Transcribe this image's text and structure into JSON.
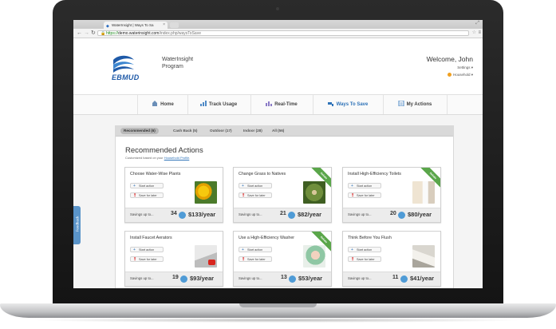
{
  "browser": {
    "tab_title": "WaterInsight | Ways To Sa",
    "url_prefix": "https://",
    "url_host": "demo.waterinsight.com",
    "url_path": "/index.php/waysToSave",
    "back_icon": "back-arrow-icon",
    "forward_icon": "forward-arrow-icon",
    "reload_icon": "reload-icon"
  },
  "header": {
    "logo_text": "EBMUD",
    "program_line1": "WaterInsight",
    "program_line2": "Program",
    "welcome": "Welcome, John",
    "settings": "Settings ▾",
    "household": "Household ▾"
  },
  "nav": {
    "items": [
      {
        "label": "Home",
        "icon": "home-icon"
      },
      {
        "label": "Track Usage",
        "icon": "chart-icon"
      },
      {
        "label": "Real-Time",
        "icon": "realtime-chart-icon"
      },
      {
        "label": "Ways To Save",
        "icon": "faucet-icon"
      },
      {
        "label": "My Actions",
        "icon": "clipboard-icon"
      }
    ]
  },
  "filters": {
    "items": [
      "Recommended (6)",
      "Cash Back (5)",
      "Outdoor (17)",
      "Indoor (28)",
      "All (56)"
    ]
  },
  "recommended": {
    "title": "Recommended Actions",
    "subtitle_prefix": "Customized based on your ",
    "subtitle_link": "Household Profile",
    "subtitle_suffix": "."
  },
  "cards": [
    {
      "title": "Choose Water-Wise Plants",
      "start": "Start action",
      "save": "Save for later",
      "savings_label": "Savings up to...",
      "gallons": "34",
      "money": "$133/year",
      "rebate": false
    },
    {
      "title": "Change Grass to Natives",
      "start": "Start action",
      "save": "Save for later",
      "savings_label": "Savings up to...",
      "gallons": "21",
      "money": "$82/year",
      "rebate": true
    },
    {
      "title": "Install High-Efficiency Toilets",
      "start": "Start action",
      "save": "Save for later",
      "savings_label": "Savings up to...",
      "gallons": "20",
      "money": "$80/year",
      "rebate": true
    },
    {
      "title": "Install Faucet Aerators",
      "start": "Start action",
      "save": "Save for later",
      "savings_label": "Savings up to...",
      "gallons": "19",
      "money": "$93/year",
      "rebate": false
    },
    {
      "title": "Use a High-Efficiency Washer",
      "start": "Start action",
      "save": "Save for later",
      "savings_label": "Savings up to...",
      "gallons": "13",
      "money": "$53/year",
      "rebate": true
    },
    {
      "title": "Think Before You Flush",
      "start": "Start action",
      "save": "Save for later",
      "savings_label": "Savings up to...",
      "gallons": "11",
      "money": "$41/year",
      "rebate": false
    }
  ],
  "ribbon_label": "Rebate",
  "feedback": "Feedback",
  "colors": {
    "brand_blue": "#2f73b8",
    "ribbon_green": "#5aa64a",
    "drop_blue": "#4f9bd6"
  }
}
